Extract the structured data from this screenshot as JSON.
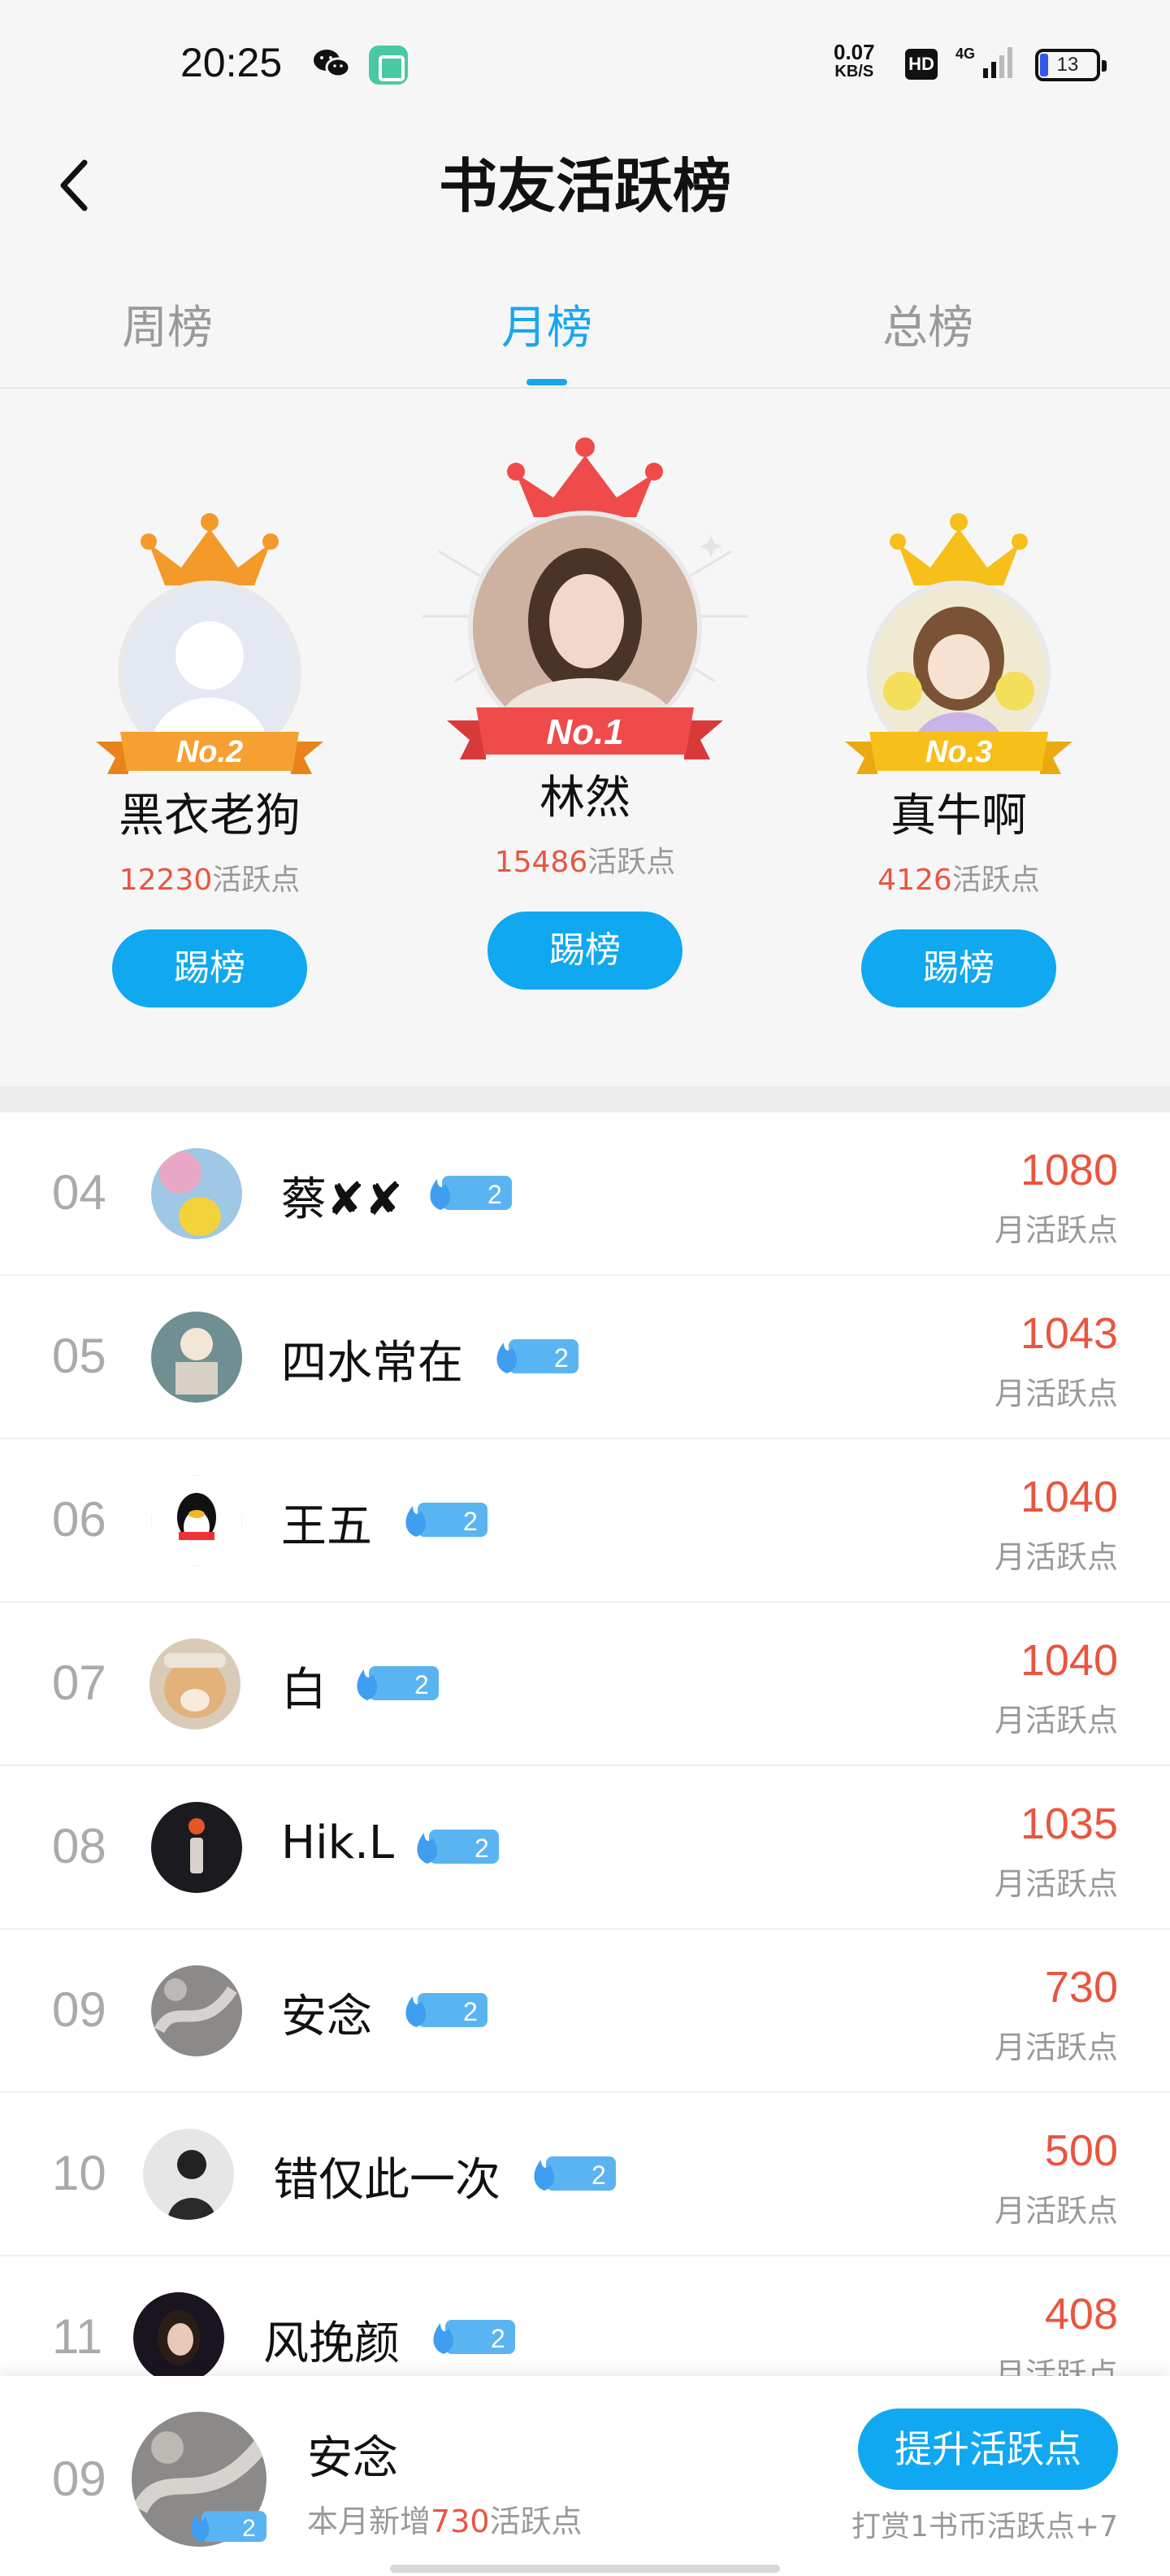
{
  "status_bar": {
    "time": "20:25",
    "net_speed_value": "0.07",
    "net_speed_unit": "KB/S",
    "hd_label": "HD",
    "network_type": "4G",
    "battery_level": "13"
  },
  "header": {
    "title": "书友活跃榜"
  },
  "tabs": [
    {
      "label": "周榜",
      "active": false
    },
    {
      "label": "月榜",
      "active": true
    },
    {
      "label": "总榜",
      "active": false
    }
  ],
  "podium": {
    "first": {
      "rank_label": "No.1",
      "name": "林然",
      "points": "15486",
      "points_suffix": "活跃点",
      "button_label": "踢榜"
    },
    "second": {
      "rank_label": "No.2",
      "name": "黑衣老狗",
      "points": "12230",
      "points_suffix": "活跃点",
      "button_label": "踢榜"
    },
    "third": {
      "rank_label": "No.3",
      "name": "真牛啊",
      "points": "4126",
      "points_suffix": "活跃点",
      "button_label": "踢榜"
    }
  },
  "rank_list": {
    "unit_label": "月活跃点",
    "rows": [
      {
        "rank": "04",
        "name": "蔡✘✘",
        "level": "2",
        "score": "1080"
      },
      {
        "rank": "05",
        "name": "四水常在",
        "level": "2",
        "score": "1043"
      },
      {
        "rank": "06",
        "name": "王五",
        "level": "2",
        "score": "1040"
      },
      {
        "rank": "07",
        "name": "白",
        "level": "2",
        "score": "1040"
      },
      {
        "rank": "08",
        "name": "Hik.L",
        "level": "2",
        "score": "1035"
      },
      {
        "rank": "09",
        "name": "安念",
        "level": "2",
        "score": "730"
      },
      {
        "rank": "10",
        "name": "错仅此一次",
        "level": "2",
        "score": "500"
      },
      {
        "rank": "11",
        "name": "风挽颜",
        "level": "2",
        "score": "408"
      }
    ]
  },
  "me": {
    "rank": "09",
    "name": "安念",
    "level": "2",
    "sub_prefix": "本月新增",
    "sub_value": "730",
    "sub_suffix": "活跃点",
    "boost_button": "提升活跃点",
    "boost_hint": "打赏1书币活跃点+7"
  },
  "colors": {
    "accent": "#10a8f0",
    "score_red": "#e9553f",
    "gold": "#f5b800",
    "silver_orange": "#f08a24",
    "first_red": "#ee4a4a"
  }
}
